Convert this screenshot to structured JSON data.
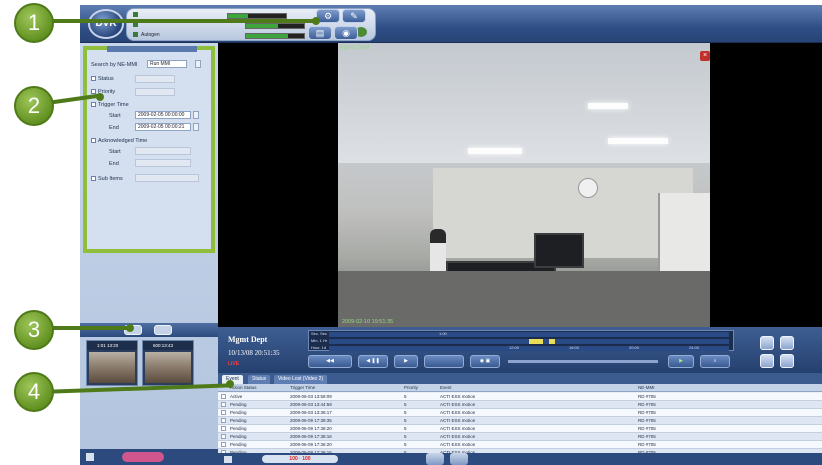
{
  "logo": {
    "text": "DVR"
  },
  "status": {
    "rows": [
      {
        "name": "",
        "value": ""
      },
      {
        "name": "",
        "value": ""
      },
      {
        "name": "Autogen",
        "value": ""
      }
    ],
    "meters": [
      0.35,
      0.55,
      0.72
    ]
  },
  "callouts": [
    "1",
    "2",
    "3",
    "4"
  ],
  "search_panel": {
    "search_by_label": "Search by NE-MMI",
    "search_by_value": "Run MMI",
    "status_label": "Status",
    "priority_label": "Priority",
    "trigger_time_label": "Trigger Time",
    "start_label": "Start",
    "start_value": "2009-02-05 00:00:00",
    "end_label": "End",
    "end_value": "2009-02-05 00:00:21",
    "ack_time_label": "Acknowledged Time",
    "ack_start_label": "Start",
    "ack_end_label": "End",
    "sub_items_label": "Sub Items"
  },
  "thumbnails": [
    {
      "label": "1:01 13:20"
    },
    {
      "label": "600:13:43"
    }
  ],
  "video": {
    "camera_label": "Mgmt Dept",
    "timestamp": "2009-02-10 19:51:35"
  },
  "timeline": {
    "camera_name": "Mgmt Dept",
    "camera_time": "10/13/08 20:51:35",
    "live_badge": "LIVE",
    "track_labels": [
      "Sec. Sec",
      "Min. 1 Hr",
      "Hour. 1d"
    ],
    "ticks": [
      "1:00",
      "12:00",
      "16:00",
      "20:00",
      "24:00"
    ]
  },
  "events": {
    "tabs": [
      "Event",
      "Status",
      "Video Lost (Video 2)"
    ],
    "columns": [
      "Action Status",
      "Trigger Time",
      "Priority",
      "Event",
      "NE-MMI"
    ],
    "rows": [
      {
        "status": "Active",
        "time": "2009-06-03 13:58:09",
        "priority": "5",
        "event": "ACTI ESS motion",
        "ne": "RD #705"
      },
      {
        "status": "Pending",
        "time": "2009-06-03 13:44:59",
        "priority": "5",
        "event": "ACTI ESS motion",
        "ne": "RD #705"
      },
      {
        "status": "Pending",
        "time": "2009-06-03 13:36:17",
        "priority": "5",
        "event": "ACTI ESS motion",
        "ne": "RD #705"
      },
      {
        "status": "Pending",
        "time": "2009-06-09 17:39:35",
        "priority": "5",
        "event": "ACTI ESS motion",
        "ne": "RD #705"
      },
      {
        "status": "Pending",
        "time": "2009-06-09 17:38:20",
        "priority": "5",
        "event": "ACTI ESS motion",
        "ne": "RD #705"
      },
      {
        "status": "Pending",
        "time": "2009-06-09 17:38:16",
        "priority": "5",
        "event": "ACTI ESS motion",
        "ne": "RD #705"
      },
      {
        "status": "Pending",
        "time": "2009-06-09 17:36:20",
        "priority": "5",
        "event": "ACTI ESS motion",
        "ne": "RD #705"
      },
      {
        "status": "Pending",
        "time": "2009-06-09 17:36:16",
        "priority": "5",
        "event": "ACTI ESS motion",
        "ne": "RD #705"
      }
    ]
  },
  "bottom": {
    "progress_text": "100 · 100"
  },
  "colors": {
    "callout_green": "#6f9c28",
    "panel_border_green": "#8fbf3a",
    "header_blue": "#2f4f86"
  }
}
